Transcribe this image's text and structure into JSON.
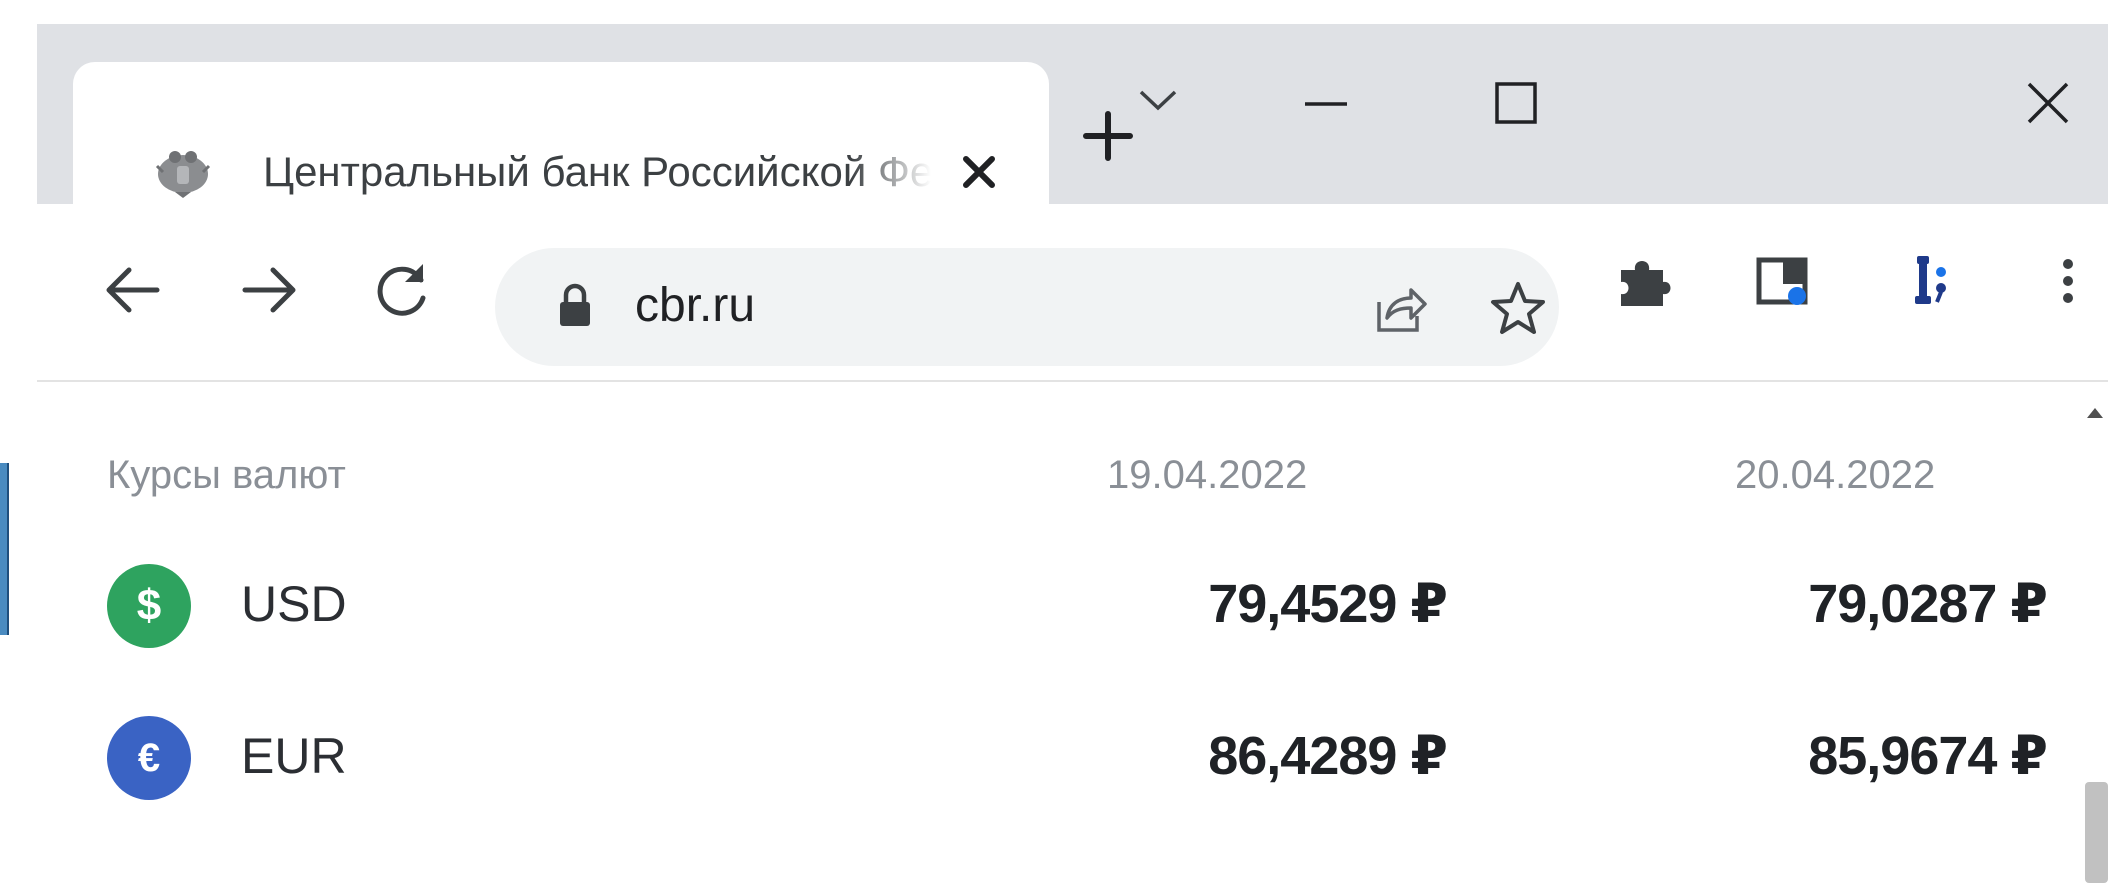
{
  "browser": {
    "tab": {
      "title": "Центральный банк Российской Федерации"
    },
    "address": {
      "url": "cbr.ru"
    },
    "icons": {
      "favicon": "cbr-eagle-icon",
      "tab_close": "close-icon",
      "new_tab": "plus-icon",
      "tab_search": "chevron-down-icon",
      "minimize": "minimize-icon",
      "maximize": "maximize-icon",
      "close_window": "close-icon",
      "back": "arrow-left-icon",
      "forward": "arrow-right-icon",
      "reload": "reload-icon",
      "lock": "lock-icon",
      "share": "share-icon",
      "bookmark": "star-icon",
      "extensions": "puzzle-icon",
      "side_panel": "side-panel-icon",
      "profile_ext": "extension-icon",
      "menu": "kebab-menu-icon"
    }
  },
  "rates": {
    "header": {
      "label": "Курсы валют",
      "date1": "19.04.2022",
      "date2": "20.04.2022"
    },
    "rows": [
      {
        "code": "USD",
        "symbol": "$",
        "rate1": "79,4529 ₽",
        "rate2": "79,0287 ₽",
        "color": "#2ea35f"
      },
      {
        "code": "EUR",
        "symbol": "€",
        "rate1": "86,4289 ₽",
        "rate2": "85,9674 ₽",
        "color": "#3a63c4"
      }
    ]
  },
  "colors": {
    "tabstrip": "#dfe1e5",
    "omnibox": "#f1f3f4",
    "usd_badge": "#2ea35f",
    "eur_badge": "#3a63c4"
  }
}
